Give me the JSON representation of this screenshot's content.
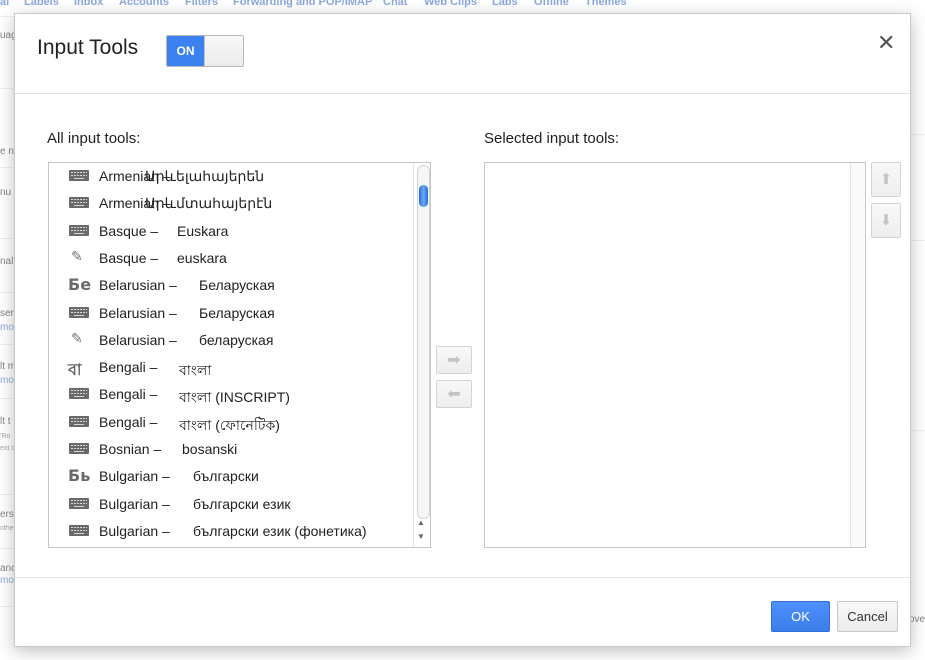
{
  "background": {
    "tabs": [
      "al",
      "Labels",
      "Inbox",
      "Accounts",
      "Filters",
      "Forwarding and POP/IMAP",
      "Chat",
      "Web Clips",
      "Labs",
      "Offline",
      "Themes"
    ],
    "left_snippets": [
      "uag",
      "e n",
      "nu",
      "nal",
      "ser",
      "mo",
      "lt m",
      "mo",
      "lt t",
      "'Ro",
      "ext d",
      "ers",
      "othe",
      "anc",
      "mo"
    ],
    "right_snippet": "ove"
  },
  "dialog": {
    "title": "Input Tools",
    "toggle_label": "ON",
    "close_icon": "close-icon",
    "all_tools_label": "All input tools:",
    "selected_tools_label": "Selected input tools:",
    "ok_label": "OK",
    "cancel_label": "Cancel",
    "accent_color": "#3b82f0"
  },
  "all_tools": [
    {
      "icon": "keyboard-icon",
      "glyph": "",
      "name": "Armenian –",
      "native": "Արևելահայերեն"
    },
    {
      "icon": "keyboard-icon",
      "glyph": "",
      "name": "Armenian –",
      "native": "Արևմտահայերէն"
    },
    {
      "icon": "keyboard-icon",
      "glyph": "",
      "name": "Basque –",
      "native": "Euskara"
    },
    {
      "icon": "pencil-icon",
      "glyph": "✎",
      "name": "Basque –",
      "native": "euskara"
    },
    {
      "icon": "transliteration-icon",
      "glyph": "Бе",
      "name": "Belarusian –",
      "native": "Беларуская"
    },
    {
      "icon": "keyboard-icon",
      "glyph": "",
      "name": "Belarusian –",
      "native": "Беларуская"
    },
    {
      "icon": "pencil-icon",
      "glyph": "✎",
      "name": "Belarusian –",
      "native": "беларуская"
    },
    {
      "icon": "transliteration-icon",
      "glyph": "বা",
      "name": "Bengali –",
      "native": "বাংলা"
    },
    {
      "icon": "keyboard-icon",
      "glyph": "",
      "name": "Bengali –",
      "native": "বাংলা (INSCRIPT)"
    },
    {
      "icon": "keyboard-icon",
      "glyph": "",
      "name": "Bengali –",
      "native": "বাংলা (ফোনেটিক)"
    },
    {
      "icon": "keyboard-icon",
      "glyph": "",
      "name": "Bosnian –",
      "native": "bosanski"
    },
    {
      "icon": "transliteration-icon",
      "glyph": "Бь",
      "name": "Bulgarian –",
      "native": "български"
    },
    {
      "icon": "keyboard-icon",
      "glyph": "",
      "name": "Bulgarian –",
      "native": "български език"
    },
    {
      "icon": "keyboard-icon",
      "glyph": "",
      "name": "Bulgarian –",
      "native": "български език (фонетика)"
    }
  ],
  "selected_tools": [],
  "list_scroll_fraction": 0.05
}
